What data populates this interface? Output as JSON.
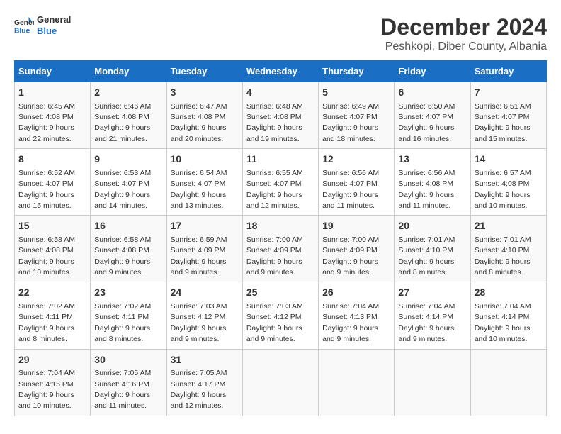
{
  "header": {
    "logo_general": "General",
    "logo_blue": "Blue",
    "title": "December 2024",
    "subtitle": "Peshkopi, Diber County, Albania"
  },
  "columns": [
    "Sunday",
    "Monday",
    "Tuesday",
    "Wednesday",
    "Thursday",
    "Friday",
    "Saturday"
  ],
  "weeks": [
    [
      {
        "day": "1",
        "sunrise": "Sunrise: 6:45 AM",
        "sunset": "Sunset: 4:08 PM",
        "daylight": "Daylight: 9 hours and 22 minutes."
      },
      {
        "day": "2",
        "sunrise": "Sunrise: 6:46 AM",
        "sunset": "Sunset: 4:08 PM",
        "daylight": "Daylight: 9 hours and 21 minutes."
      },
      {
        "day": "3",
        "sunrise": "Sunrise: 6:47 AM",
        "sunset": "Sunset: 4:08 PM",
        "daylight": "Daylight: 9 hours and 20 minutes."
      },
      {
        "day": "4",
        "sunrise": "Sunrise: 6:48 AM",
        "sunset": "Sunset: 4:08 PM",
        "daylight": "Daylight: 9 hours and 19 minutes."
      },
      {
        "day": "5",
        "sunrise": "Sunrise: 6:49 AM",
        "sunset": "Sunset: 4:07 PM",
        "daylight": "Daylight: 9 hours and 18 minutes."
      },
      {
        "day": "6",
        "sunrise": "Sunrise: 6:50 AM",
        "sunset": "Sunset: 4:07 PM",
        "daylight": "Daylight: 9 hours and 16 minutes."
      },
      {
        "day": "7",
        "sunrise": "Sunrise: 6:51 AM",
        "sunset": "Sunset: 4:07 PM",
        "daylight": "Daylight: 9 hours and 15 minutes."
      }
    ],
    [
      {
        "day": "8",
        "sunrise": "Sunrise: 6:52 AM",
        "sunset": "Sunset: 4:07 PM",
        "daylight": "Daylight: 9 hours and 15 minutes."
      },
      {
        "day": "9",
        "sunrise": "Sunrise: 6:53 AM",
        "sunset": "Sunset: 4:07 PM",
        "daylight": "Daylight: 9 hours and 14 minutes."
      },
      {
        "day": "10",
        "sunrise": "Sunrise: 6:54 AM",
        "sunset": "Sunset: 4:07 PM",
        "daylight": "Daylight: 9 hours and 13 minutes."
      },
      {
        "day": "11",
        "sunrise": "Sunrise: 6:55 AM",
        "sunset": "Sunset: 4:07 PM",
        "daylight": "Daylight: 9 hours and 12 minutes."
      },
      {
        "day": "12",
        "sunrise": "Sunrise: 6:56 AM",
        "sunset": "Sunset: 4:07 PM",
        "daylight": "Daylight: 9 hours and 11 minutes."
      },
      {
        "day": "13",
        "sunrise": "Sunrise: 6:56 AM",
        "sunset": "Sunset: 4:08 PM",
        "daylight": "Daylight: 9 hours and 11 minutes."
      },
      {
        "day": "14",
        "sunrise": "Sunrise: 6:57 AM",
        "sunset": "Sunset: 4:08 PM",
        "daylight": "Daylight: 9 hours and 10 minutes."
      }
    ],
    [
      {
        "day": "15",
        "sunrise": "Sunrise: 6:58 AM",
        "sunset": "Sunset: 4:08 PM",
        "daylight": "Daylight: 9 hours and 10 minutes."
      },
      {
        "day": "16",
        "sunrise": "Sunrise: 6:58 AM",
        "sunset": "Sunset: 4:08 PM",
        "daylight": "Daylight: 9 hours and 9 minutes."
      },
      {
        "day": "17",
        "sunrise": "Sunrise: 6:59 AM",
        "sunset": "Sunset: 4:09 PM",
        "daylight": "Daylight: 9 hours and 9 minutes."
      },
      {
        "day": "18",
        "sunrise": "Sunrise: 7:00 AM",
        "sunset": "Sunset: 4:09 PM",
        "daylight": "Daylight: 9 hours and 9 minutes."
      },
      {
        "day": "19",
        "sunrise": "Sunrise: 7:00 AM",
        "sunset": "Sunset: 4:09 PM",
        "daylight": "Daylight: 9 hours and 9 minutes."
      },
      {
        "day": "20",
        "sunrise": "Sunrise: 7:01 AM",
        "sunset": "Sunset: 4:10 PM",
        "daylight": "Daylight: 9 hours and 8 minutes."
      },
      {
        "day": "21",
        "sunrise": "Sunrise: 7:01 AM",
        "sunset": "Sunset: 4:10 PM",
        "daylight": "Daylight: 9 hours and 8 minutes."
      }
    ],
    [
      {
        "day": "22",
        "sunrise": "Sunrise: 7:02 AM",
        "sunset": "Sunset: 4:11 PM",
        "daylight": "Daylight: 9 hours and 8 minutes."
      },
      {
        "day": "23",
        "sunrise": "Sunrise: 7:02 AM",
        "sunset": "Sunset: 4:11 PM",
        "daylight": "Daylight: 9 hours and 8 minutes."
      },
      {
        "day": "24",
        "sunrise": "Sunrise: 7:03 AM",
        "sunset": "Sunset: 4:12 PM",
        "daylight": "Daylight: 9 hours and 9 minutes."
      },
      {
        "day": "25",
        "sunrise": "Sunrise: 7:03 AM",
        "sunset": "Sunset: 4:12 PM",
        "daylight": "Daylight: 9 hours and 9 minutes."
      },
      {
        "day": "26",
        "sunrise": "Sunrise: 7:04 AM",
        "sunset": "Sunset: 4:13 PM",
        "daylight": "Daylight: 9 hours and 9 minutes."
      },
      {
        "day": "27",
        "sunrise": "Sunrise: 7:04 AM",
        "sunset": "Sunset: 4:14 PM",
        "daylight": "Daylight: 9 hours and 9 minutes."
      },
      {
        "day": "28",
        "sunrise": "Sunrise: 7:04 AM",
        "sunset": "Sunset: 4:14 PM",
        "daylight": "Daylight: 9 hours and 10 minutes."
      }
    ],
    [
      {
        "day": "29",
        "sunrise": "Sunrise: 7:04 AM",
        "sunset": "Sunset: 4:15 PM",
        "daylight": "Daylight: 9 hours and 10 minutes."
      },
      {
        "day": "30",
        "sunrise": "Sunrise: 7:05 AM",
        "sunset": "Sunset: 4:16 PM",
        "daylight": "Daylight: 9 hours and 11 minutes."
      },
      {
        "day": "31",
        "sunrise": "Sunrise: 7:05 AM",
        "sunset": "Sunset: 4:17 PM",
        "daylight": "Daylight: 9 hours and 12 minutes."
      },
      null,
      null,
      null,
      null
    ]
  ]
}
